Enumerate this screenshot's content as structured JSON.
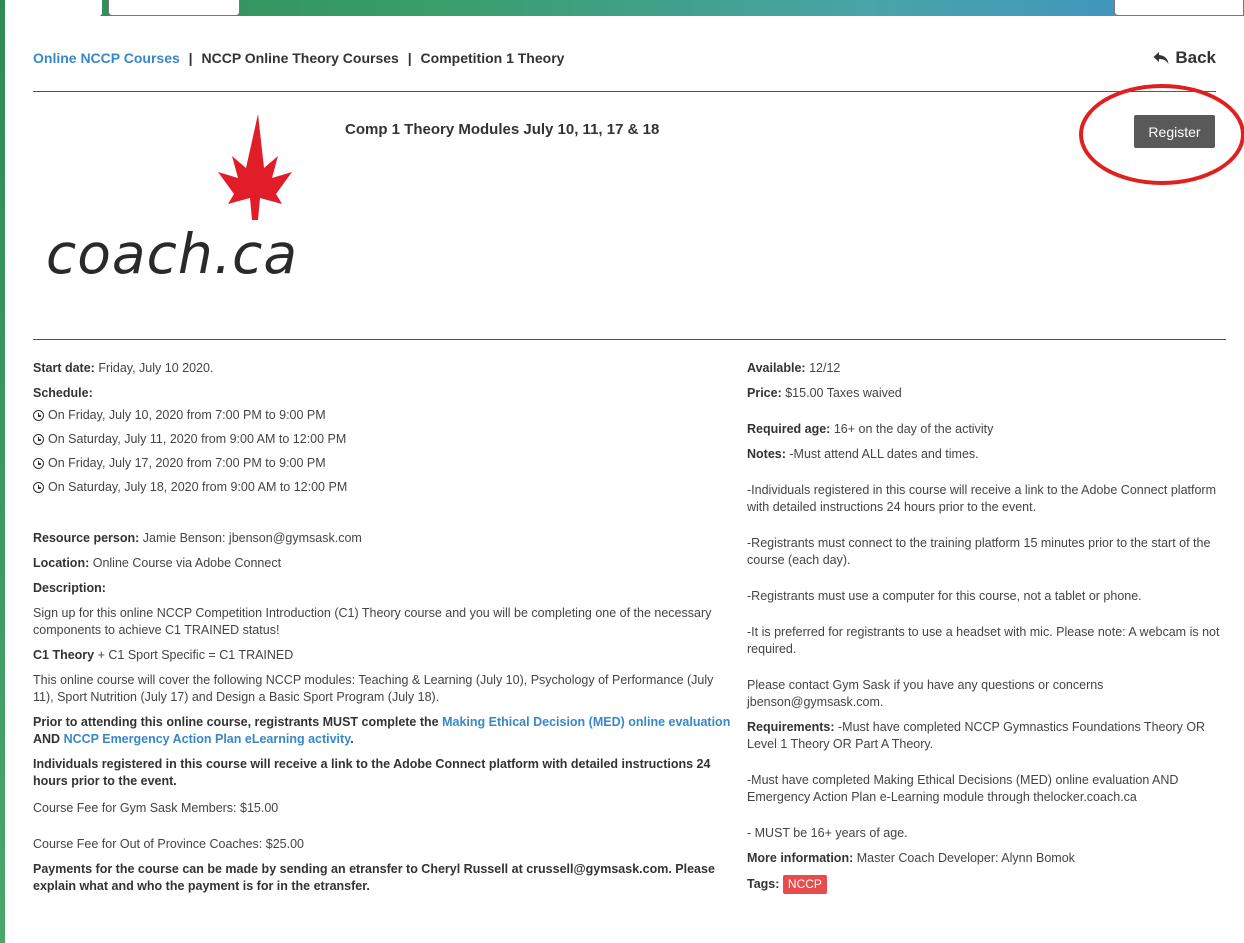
{
  "breadcrumb": {
    "link": "Online NCCP Courses",
    "sep1": "|",
    "item2": "NCCP Online Theory Courses",
    "sep2": "|",
    "item3": "Competition 1 Theory"
  },
  "back_label": "Back",
  "logo_text": "coach.ca",
  "course_title": "Comp 1 Theory Modules July 10, 11, 17 & 18",
  "register_label": "Register",
  "left": {
    "start_label": "Start date:",
    "start_value": "Friday, July 10 2020.",
    "schedule_label": "Schedule:",
    "schedule": [
      "On Friday, July 10, 2020 from 7:00 PM to 9:00 PM",
      "On Saturday, July 11, 2020 from 9:00 AM to 12:00 PM",
      "On Friday, July 17, 2020 from 7:00 PM to 9:00 PM",
      "On Saturday, July 18, 2020 from 9:00 AM to 12:00 PM"
    ],
    "resource_label": "Resource person:",
    "resource_value": "Jamie Benson: jbenson@gymsask.com",
    "location_label": "Location:",
    "location_value": "Online Course via Adobe Connect",
    "description_label": "Description:",
    "desc_p1": "Sign up for this online NCCP Competition Introduction (C1) Theory course and you will be completing one of the necessary components to achieve C1 TRAINED status!",
    "desc_c1_bold": "C1 Theory",
    "desc_c1_rest": " + C1 Sport Specific = C1 TRAINED",
    "desc_p3": "This online course will cover the following NCCP modules: Teaching & Learning (July 10), Psychology of Performance (July 11), Sport Nutrition (July 17) and Design a Basic Sport Program (July 18).",
    "desc_p4_a": "Prior to attending this online course, registrants MUST complete the ",
    "desc_p4_link1": "Making Ethical Decision (MED) online evaluation",
    "desc_p4_and": " AND ",
    "desc_p4_link2": "NCCP Emergency Action Plan eLearning activity",
    "desc_p4_end": ".",
    "desc_p5": "Individuals registered in this course will receive a link to the Adobe Connect platform with detailed instructions 24 hours prior to the event.",
    "fee_members": "Course Fee for Gym Sask Members: $15.00",
    "fee_out": "Course Fee for Out of Province Coaches: $25.00",
    "payments": "Payments for the course can be made by sending an etransfer to Cheryl Russell at crussell@gymsask.com.  Please explain what and who the payment is for in the etransfer."
  },
  "right": {
    "available_label": "Available:",
    "available_value": "12/12",
    "price_label": "Price:",
    "price_value": "$15.00 Taxes waived",
    "age_label": "Required age:",
    "age_value": "16+ on the day of the activity",
    "notes_label": "Notes:",
    "notes_first": "-Must attend ALL dates and times.",
    "notes": [
      "-Individuals registered in this course will receive a link to the Adobe Connect platform with detailed instructions 24 hours prior to the event.",
      "-Registrants must connect to the training platform 15 minutes prior to the start of the course (each day).",
      "-Registrants must use a computer for this course, not a tablet or phone.",
      "-It is preferred for registrants to use a headset with mic. Please note: A webcam is not required.",
      "Please contact Gym Sask if you have any questions or concerns jbenson@gymsask.com."
    ],
    "req_label": "Requirements:",
    "req_first": "-Must have completed NCCP Gymnastics Foundations Theory OR Level 1 Theory OR Part A Theory.",
    "req_second": "-Must have completed Making Ethical Decisions (MED) online evaluation AND Emergency Action Plan e-Learning module through thelocker.coach.ca",
    "req_third": "- MUST be 16+ years of age.",
    "more_label": "More information:",
    "more_value": "Master Coach Developer: Alynn Bomok",
    "tags_label": "Tags:",
    "tag": "NCCP"
  },
  "colors": {
    "link_blue": "#3a87c8",
    "register_bg": "#595959",
    "highlight_red": "#e02020",
    "tag_red": "#e84b4b"
  }
}
